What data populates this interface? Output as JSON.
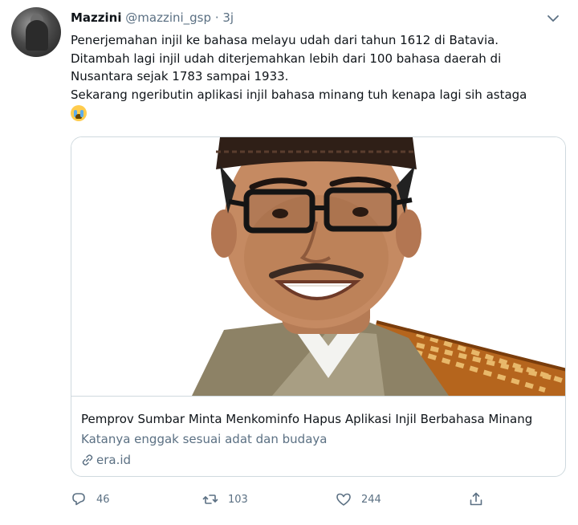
{
  "tweet": {
    "author_name": "Mazzini",
    "author_handle": "@mazzini_gsp",
    "separator": "·",
    "time": "3j",
    "text_lines": [
      "Penerjemahan injil ke bahasa melayu udah dari tahun 1612 di Batavia.",
      "Ditambah lagi injil udah diterjemahkan lebih dari 100 bahasa daerah di",
      "Nusantara sejak 1783 sampai 1933.",
      "Sekarang ngeributin aplikasi injil bahasa minang tuh kenapa lagi sih astaga"
    ],
    "emoji": "loudly-crying-face"
  },
  "card": {
    "title": "Pemprov Sumbar Minta Menkominfo Hapus Aplikasi Injil Berbahasa Minang",
    "description": "Katanya enggak sesuai adat dan budaya",
    "domain": "era.id"
  },
  "actions": {
    "reply_count": "46",
    "retweet_count": "103",
    "like_count": "244"
  },
  "colors": {
    "text": "#0f1419",
    "secondary": "#5b7083",
    "border": "#cfd9de"
  }
}
